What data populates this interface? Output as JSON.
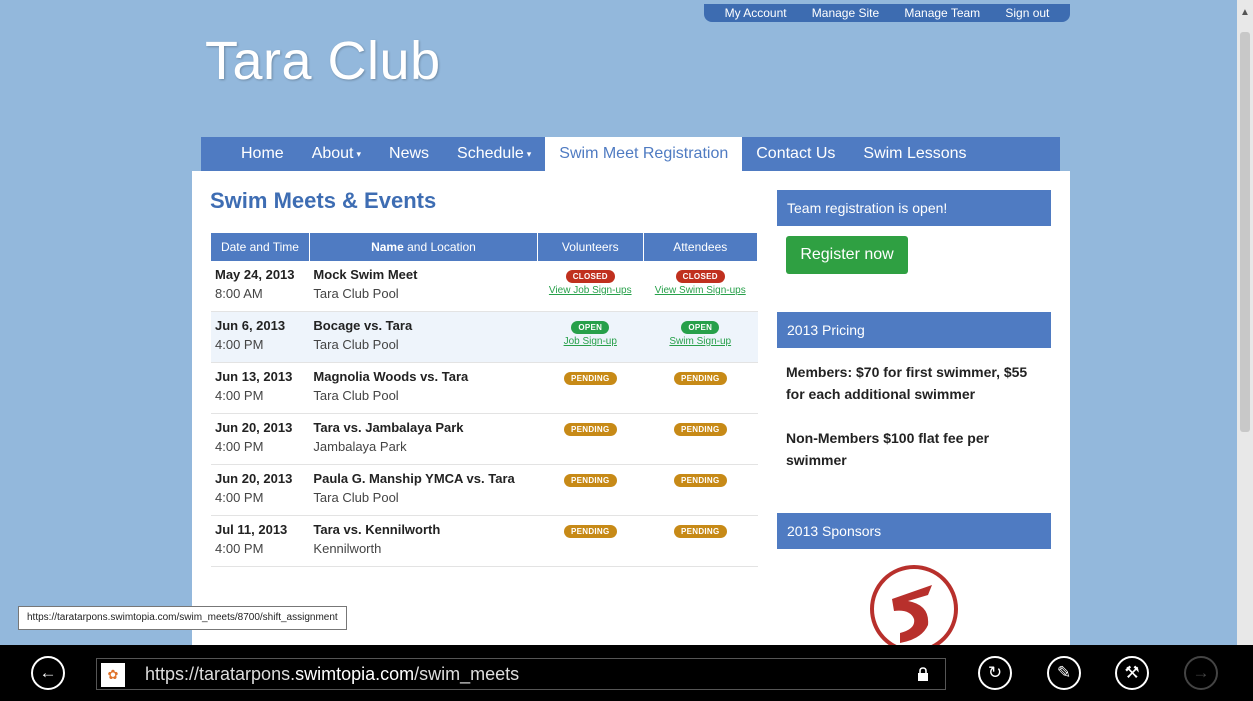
{
  "top_links": [
    "My Account",
    "Manage Site",
    "Manage Team",
    "Sign out"
  ],
  "site_title": "Tara Club",
  "nav": {
    "home": "Home",
    "about": "About",
    "news": "News",
    "schedule": "Schedule",
    "swim_meet_registration": "Swim Meet Registration",
    "contact_us": "Contact Us",
    "swim_lessons": "Swim Lessons"
  },
  "main": {
    "heading": "Swim Meets & Events",
    "columns": {
      "date_time": "Date and Time",
      "name_bold": "Name",
      "name_rest": " and Location",
      "volunteers": "Volunteers",
      "attendees": "Attendees"
    },
    "meets": [
      {
        "date": "May 24, 2013",
        "time": "8:00 AM",
        "name": "Mock Swim Meet",
        "location": "Tara Club Pool",
        "vol_status": "CLOSED",
        "vol_link": "View Job Sign-ups",
        "att_status": "CLOSED",
        "att_link": "View Swim Sign-ups"
      },
      {
        "date": "Jun 6, 2013",
        "time": "4:00 PM",
        "name": "Bocage vs. Tara",
        "location": "Tara Club Pool",
        "vol_status": "OPEN",
        "vol_link": "Job Sign-up",
        "att_status": "OPEN",
        "att_link": "Swim Sign-up"
      },
      {
        "date": "Jun 13, 2013",
        "time": "4:00 PM",
        "name": "Magnolia Woods vs. Tara",
        "location": "Tara Club Pool",
        "vol_status": "PENDING",
        "att_status": "PENDING"
      },
      {
        "date": "Jun 20, 2013",
        "time": "4:00 PM",
        "name": "Tara vs. Jambalaya Park",
        "location": "Jambalaya Park",
        "vol_status": "PENDING",
        "att_status": "PENDING"
      },
      {
        "date": "Jun 20, 2013",
        "time": "4:00 PM",
        "name": "Paula G. Manship YMCA vs. Tara",
        "location": "Tara Club Pool",
        "vol_status": "PENDING",
        "att_status": "PENDING"
      },
      {
        "date": "Jul 11, 2013",
        "time": "4:00 PM",
        "name": "Tara vs. Kennilworth",
        "location": "Kennilworth",
        "vol_status": "PENDING",
        "att_status": "PENDING"
      }
    ]
  },
  "sidebar": {
    "team_reg": "Team registration is open!",
    "register_button": "Register now",
    "pricing_heading": "2013 Pricing",
    "pricing_members": "Members: $70 for first swimmer, $55 for each additional swimmer",
    "pricing_nonmembers": "Non-Members $100 flat fee per swimmer",
    "sponsors_heading": "2013 Sponsors"
  },
  "status_url": "https://taratarpons.swimtopia.com/swim_meets/8700/shift_assignment",
  "address_bar": {
    "prefix": "https://taratarpons.",
    "domain": "swimtopia.com",
    "path": "/swim_meets"
  },
  "colors": {
    "background": "#93b8dc",
    "nav": "#4f7bc2",
    "closed": "#c0301e",
    "open": "#27a04a",
    "pending": "#c78a17"
  }
}
